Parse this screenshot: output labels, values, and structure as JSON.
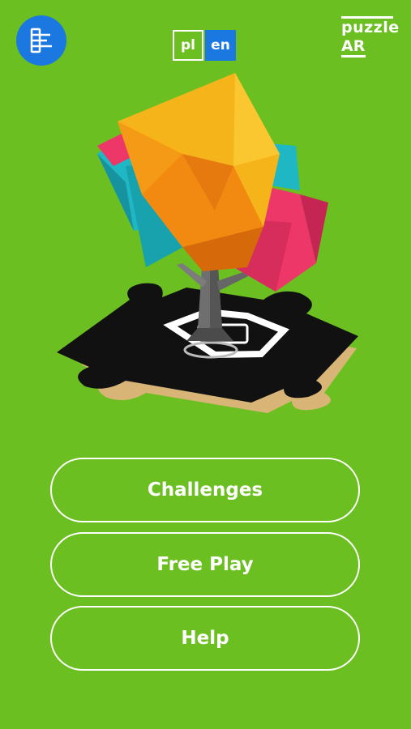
{
  "header": {
    "app_icon": "grid-list-icon",
    "languages": [
      {
        "code": "pl",
        "label": "pl",
        "selected": false
      },
      {
        "code": "en",
        "label": "en",
        "selected": true
      }
    ],
    "brand": {
      "top": "puzzle",
      "bottom": "AR"
    }
  },
  "hero": {
    "illustration": "low-poly-tree-on-puzzle-piece",
    "colors": {
      "yellow": "#f6b41b",
      "orange": "#f28a12",
      "teal": "#1fb7c4",
      "pink": "#ec3768",
      "trunk": "#6f6f6f",
      "puzzle": "#111111",
      "edge": "#d9b477"
    }
  },
  "menu": {
    "challenges": "Challenges",
    "free_play": "Free Play",
    "help": "Help"
  },
  "colors": {
    "background": "#6cbf21",
    "accent": "#1b78e0"
  }
}
